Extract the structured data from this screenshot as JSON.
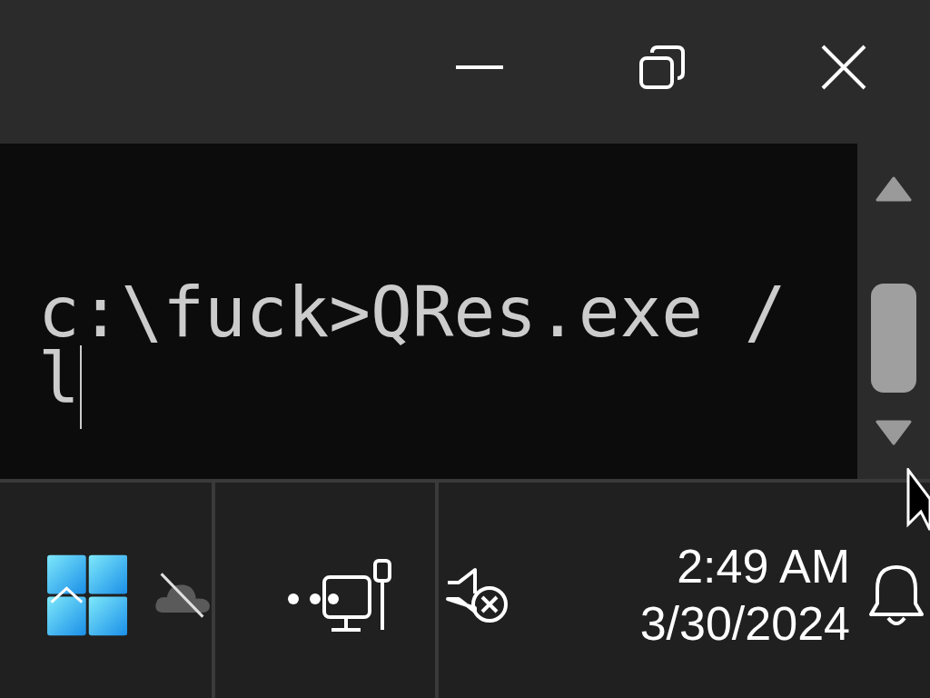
{
  "terminal": {
    "lines": [
      "c:\\fuck>QRes.exe /",
      "l"
    ],
    "cursor": true
  },
  "taskbar": {
    "clock": {
      "time": "2:49 AM",
      "date": "3/30/2024"
    }
  }
}
